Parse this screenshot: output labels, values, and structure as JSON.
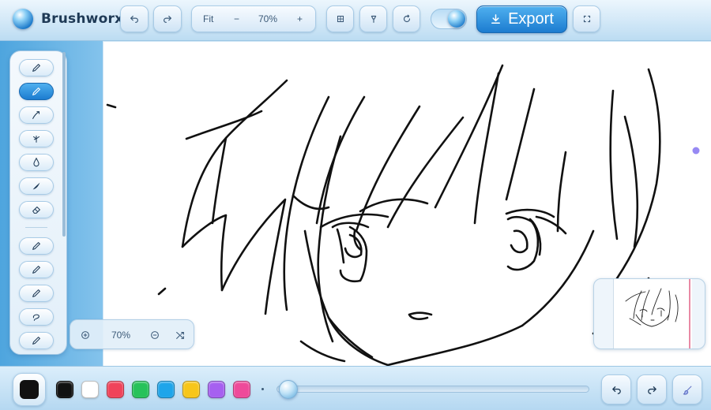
{
  "app": {
    "title": "Brushworx"
  },
  "toolbar": {
    "undo_icon": "undo-icon",
    "redo_icon": "redo-icon",
    "zoom_fit_label": "Fit",
    "zoom_out_label": "−",
    "zoom_value": "70%",
    "zoom_in_label": "+",
    "grid_icon": "grid-icon",
    "pin_icon": "pin-icon",
    "reset_icon": "rotate-icon",
    "export_label": "Export",
    "fullscreen_icon": "fullscreen-icon"
  },
  "tools": [
    {
      "name": "pencil",
      "active": false
    },
    {
      "name": "pen",
      "active": true
    },
    {
      "name": "brush",
      "active": false
    },
    {
      "name": "airbrush",
      "active": false
    },
    {
      "name": "drop",
      "active": false
    },
    {
      "name": "ink",
      "active": false
    },
    {
      "name": "eraser",
      "active": false
    },
    {
      "name": "pencil-2",
      "active": false
    },
    {
      "name": "pencil-3",
      "active": false
    },
    {
      "name": "pencil-4",
      "active": false
    },
    {
      "name": "lasso",
      "active": false
    },
    {
      "name": "pencil-5",
      "active": false
    }
  ],
  "zoom_overlay": {
    "value": "70%"
  },
  "colors": {
    "current": "#111111",
    "swatches": [
      "#111111",
      "#ffffff",
      "#f0435a",
      "#27c25a",
      "#1ea5ea",
      "#f7c61a",
      "#a660f0",
      "#ee4a9a"
    ],
    "accent": "#1c7cd0"
  },
  "brush_size": {
    "value": 0.02
  }
}
